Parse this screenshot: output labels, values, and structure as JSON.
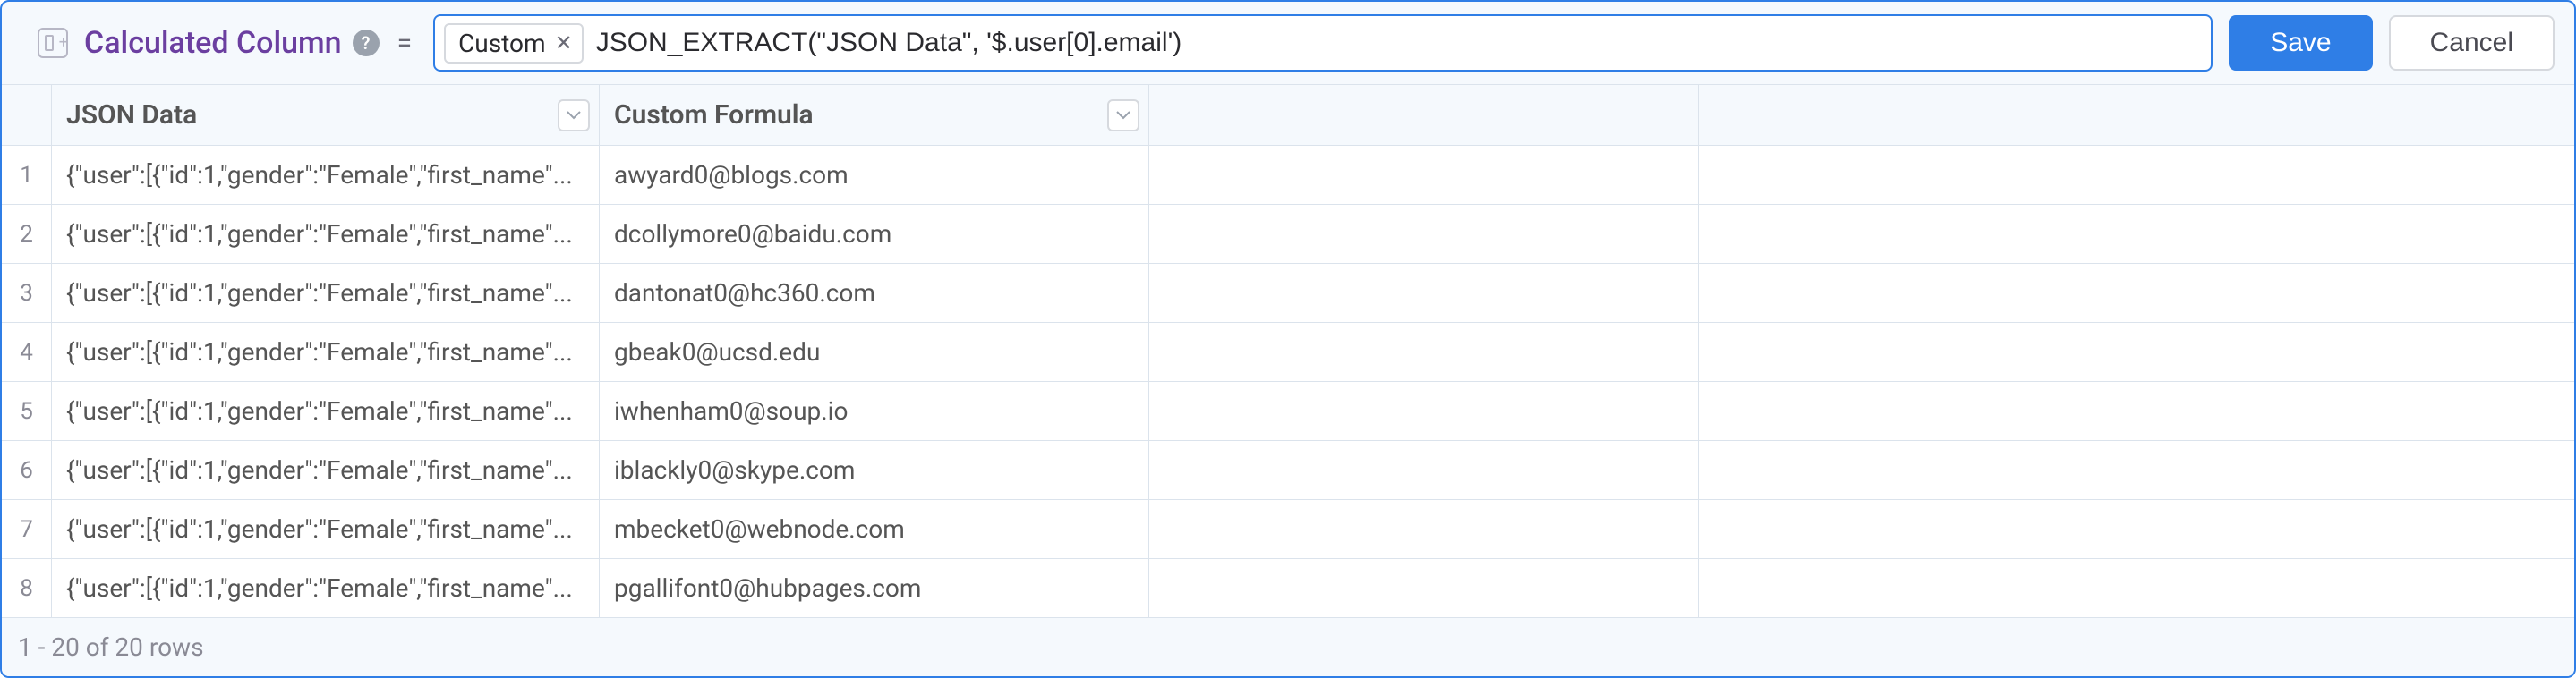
{
  "header": {
    "title": "Calculated Column",
    "equals": "=",
    "chip_label": "Custom",
    "formula": "JSON_EXTRACT(\"JSON Data\", '$.user[0].email')",
    "save_label": "Save",
    "cancel_label": "Cancel",
    "help_badge": "?"
  },
  "table": {
    "columns": [
      "JSON Data",
      "Custom Formula"
    ],
    "rows": [
      {
        "n": "1",
        "json": "{\"user\":[{\"id\":1,\"gender\":\"Female\",\"first_name\"...",
        "formula": "awyard0@blogs.com"
      },
      {
        "n": "2",
        "json": "{\"user\":[{\"id\":1,\"gender\":\"Female\",\"first_name\"...",
        "formula": "dcollymore0@baidu.com"
      },
      {
        "n": "3",
        "json": "{\"user\":[{\"id\":1,\"gender\":\"Female\",\"first_name\"...",
        "formula": "dantonat0@hc360.com"
      },
      {
        "n": "4",
        "json": "{\"user\":[{\"id\":1,\"gender\":\"Female\",\"first_name\"...",
        "formula": "gbeak0@ucsd.edu"
      },
      {
        "n": "5",
        "json": "{\"user\":[{\"id\":1,\"gender\":\"Female\",\"first_name\"...",
        "formula": "iwhenham0@soup.io"
      },
      {
        "n": "6",
        "json": "{\"user\":[{\"id\":1,\"gender\":\"Female\",\"first_name\"...",
        "formula": "iblackly0@skype.com"
      },
      {
        "n": "7",
        "json": "{\"user\":[{\"id\":1,\"gender\":\"Female\",\"first_name\"...",
        "formula": "mbecket0@webnode.com"
      },
      {
        "n": "8",
        "json": "{\"user\":[{\"id\":1,\"gender\":\"Female\",\"first_name\"...",
        "formula": "pgallifont0@hubpages.com"
      }
    ]
  },
  "footer": {
    "row_count_text": "1 - 20 of 20 rows"
  }
}
